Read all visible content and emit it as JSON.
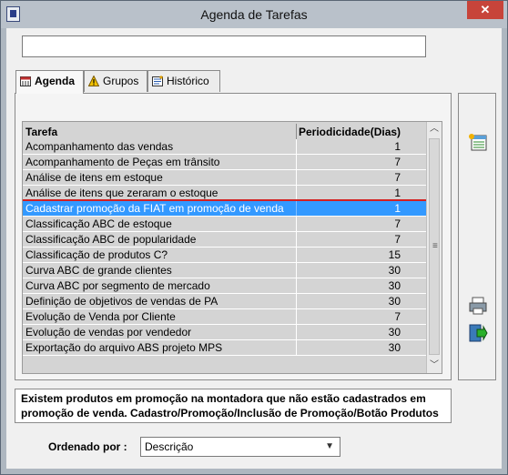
{
  "window": {
    "title": "Agenda de Tarefas",
    "close_label": "✕"
  },
  "search": {
    "value": ""
  },
  "tabs": [
    {
      "label": "Agenda",
      "icon": "calendar-icon"
    },
    {
      "label": "Grupos",
      "icon": "warning-icon"
    },
    {
      "label": "Histórico",
      "icon": "history-icon"
    }
  ],
  "table": {
    "columns": [
      "Tarefa",
      "Periodicidade(Dias)"
    ],
    "rows": [
      {
        "tarefa": "Acompanhamento das vendas",
        "dias": "1"
      },
      {
        "tarefa": "Acompanhamento de Peças em trânsito",
        "dias": "7"
      },
      {
        "tarefa": "Análise de itens em estoque",
        "dias": "7"
      },
      {
        "tarefa": "Análise de itens que zeraram o estoque",
        "dias": "1"
      },
      {
        "tarefa": "Cadastrar promoção da FIAT em promoção de venda",
        "dias": "1",
        "selected": true
      },
      {
        "tarefa": "Classificação ABC de estoque",
        "dias": "7"
      },
      {
        "tarefa": "Classificação ABC de popularidade",
        "dias": "7"
      },
      {
        "tarefa": "Classificação de produtos C?",
        "dias": "15"
      },
      {
        "tarefa": "Curva ABC de grande clientes",
        "dias": "30"
      },
      {
        "tarefa": "Curva ABC por segmento de mercado",
        "dias": "30"
      },
      {
        "tarefa": "Definição de objetivos de vendas de PA",
        "dias": "30"
      },
      {
        "tarefa": "Evolução de Venda por Cliente",
        "dias": "7"
      },
      {
        "tarefa": "Evolução de vendas por vendedor",
        "dias": "30"
      },
      {
        "tarefa": "Exportação do arquivo ABS projeto MPS",
        "dias": "30"
      }
    ]
  },
  "message": "Existem produtos em promoção na montadora que não estão cadastrados em promoção de venda. Cadastro/Promoção/Inclusão de Promoção/Botão Produtos",
  "sort": {
    "label": "Ordenado por :",
    "value": "Descrição"
  },
  "colors": {
    "selection": "#3399ff",
    "highlight_border": "#d42020"
  }
}
